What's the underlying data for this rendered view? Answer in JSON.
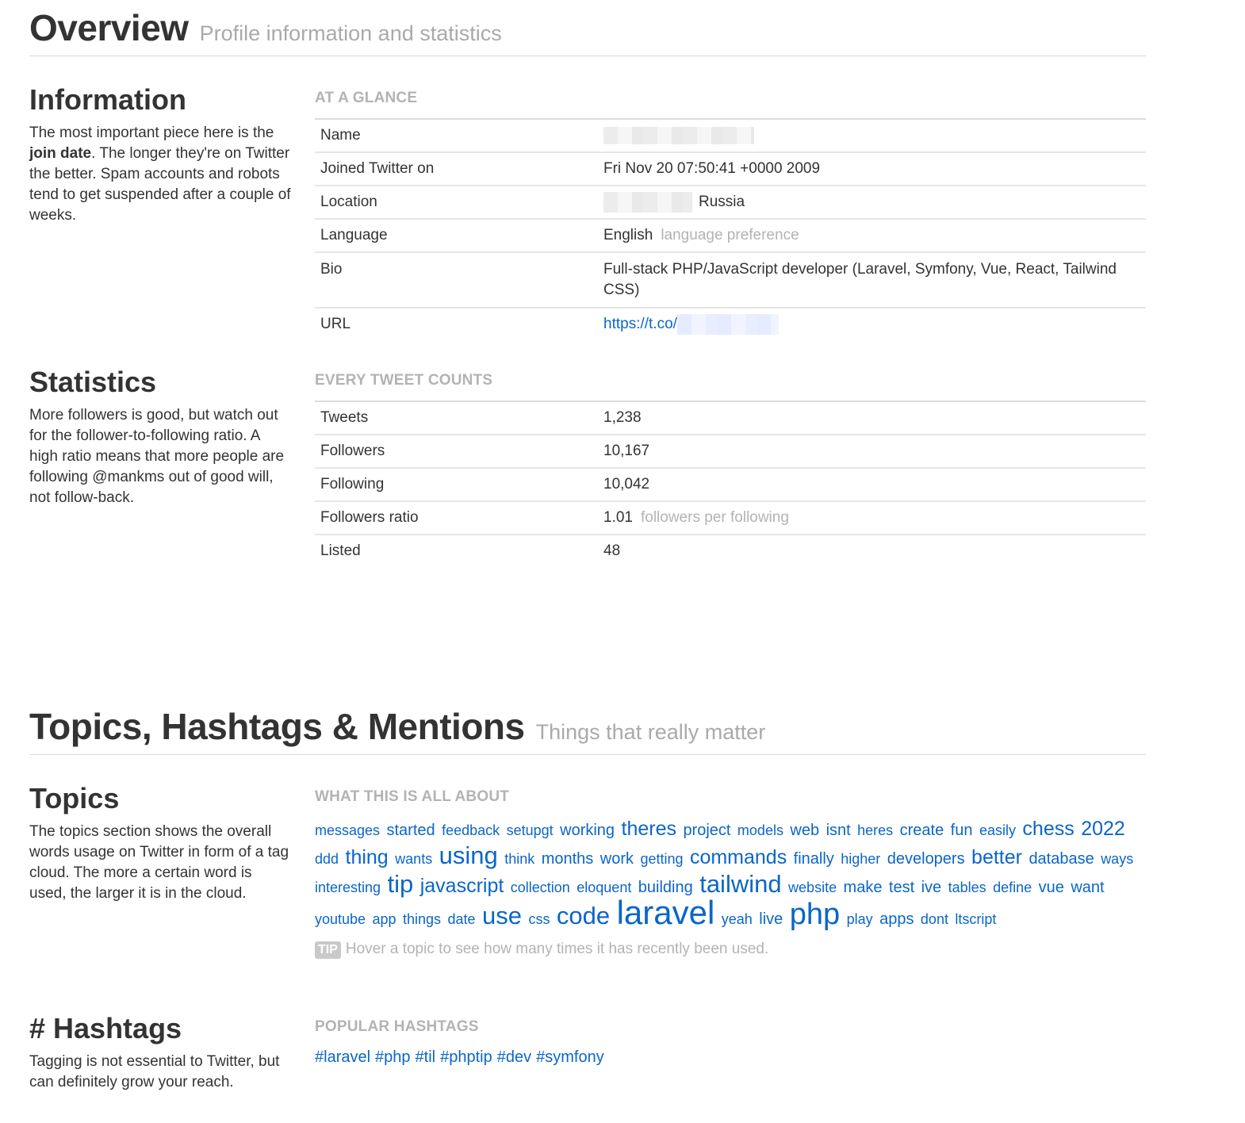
{
  "overview": {
    "title": "Overview",
    "subtitle": "Profile information and statistics"
  },
  "information": {
    "heading": "Information",
    "desc_pre": "The most important piece here is the ",
    "desc_bold": "join date",
    "desc_post": ". The longer they're on Twitter the better. Spam accounts and robots tend to get suspended after a couple of weeks.",
    "caption": "AT A GLANCE",
    "rows": {
      "name_label": "Name",
      "joined_label": "Joined Twitter on",
      "joined_value": "Fri Nov 20 07:50:41 +0000 2009",
      "location_label": "Location",
      "location_value": "Russia",
      "language_label": "Language",
      "language_value": "English",
      "language_note": "language preference",
      "bio_label": "Bio",
      "bio_value": "Full-stack PHP/JavaScript developer (Laravel, Symfony, Vue, React, Tailwind CSS)",
      "url_label": "URL",
      "url_value": "https://t.co/"
    }
  },
  "statistics": {
    "heading": "Statistics",
    "desc": "More followers is good, but watch out for the follower-to-following ratio. A high ratio means that more people are following @mankms out of good will, not follow-back.",
    "caption": "EVERY TWEET COUNTS",
    "rows": {
      "tweets_label": "Tweets",
      "tweets_value": "1,238",
      "followers_label": "Followers",
      "followers_value": "10,167",
      "following_label": "Following",
      "following_value": "10,042",
      "ratio_label": "Followers ratio",
      "ratio_value": "1.01",
      "ratio_note": "followers per following",
      "listed_label": "Listed",
      "listed_value": "48"
    }
  },
  "topics_header": {
    "title": "Topics, Hashtags & Mentions",
    "subtitle": "Things that really matter"
  },
  "topics": {
    "heading": "Topics",
    "desc": "The topics section shows the overall words usage on Twitter in form of a tag cloud. The more a certain word is used, the larger it is in the cloud.",
    "caption": "WHAT THIS IS ALL ABOUT",
    "words": [
      {
        "text": "messages",
        "size": 1
      },
      {
        "text": "started",
        "size": 2
      },
      {
        "text": "feedback",
        "size": 1
      },
      {
        "text": "setupgt",
        "size": 1
      },
      {
        "text": "working",
        "size": 2
      },
      {
        "text": "theres",
        "size": 3
      },
      {
        "text": "project",
        "size": 2
      },
      {
        "text": "models",
        "size": 1
      },
      {
        "text": "web",
        "size": 2
      },
      {
        "text": "isnt",
        "size": 2
      },
      {
        "text": "heres",
        "size": 1
      },
      {
        "text": "create",
        "size": 2
      },
      {
        "text": "fun",
        "size": 2
      },
      {
        "text": "easily",
        "size": 1
      },
      {
        "text": "chess",
        "size": 3
      },
      {
        "text": "2022",
        "size": 3
      },
      {
        "text": "ddd",
        "size": 1
      },
      {
        "text": "thing",
        "size": 3
      },
      {
        "text": "wants",
        "size": 1
      },
      {
        "text": "using",
        "size": 4
      },
      {
        "text": "think",
        "size": 1
      },
      {
        "text": "months",
        "size": 2
      },
      {
        "text": "work",
        "size": 2
      },
      {
        "text": "getting",
        "size": 1
      },
      {
        "text": "commands",
        "size": 3
      },
      {
        "text": "finally",
        "size": 2
      },
      {
        "text": "higher",
        "size": 1
      },
      {
        "text": "developers",
        "size": 2
      },
      {
        "text": "better",
        "size": 3
      },
      {
        "text": "database",
        "size": 2
      },
      {
        "text": "ways",
        "size": 1
      },
      {
        "text": "interesting",
        "size": 1
      },
      {
        "text": "tip",
        "size": 4
      },
      {
        "text": "javascript",
        "size": 3
      },
      {
        "text": "collection",
        "size": 1
      },
      {
        "text": "eloquent",
        "size": 1
      },
      {
        "text": "building",
        "size": 2
      },
      {
        "text": "tailwind",
        "size": 4
      },
      {
        "text": "website",
        "size": 1
      },
      {
        "text": "make",
        "size": 2
      },
      {
        "text": "test",
        "size": 2
      },
      {
        "text": "ive",
        "size": 2
      },
      {
        "text": "tables",
        "size": 1
      },
      {
        "text": "define",
        "size": 1
      },
      {
        "text": "vue",
        "size": 2
      },
      {
        "text": "want",
        "size": 2
      },
      {
        "text": "youtube",
        "size": 1
      },
      {
        "text": "app",
        "size": 1
      },
      {
        "text": "things",
        "size": 1
      },
      {
        "text": "date",
        "size": 1
      },
      {
        "text": "use",
        "size": 4
      },
      {
        "text": "css",
        "size": 1
      },
      {
        "text": "code",
        "size": 4
      },
      {
        "text": "laravel",
        "size": 6
      },
      {
        "text": "yeah",
        "size": 1
      },
      {
        "text": "live",
        "size": 2
      },
      {
        "text": "php",
        "size": 5
      },
      {
        "text": "play",
        "size": 1
      },
      {
        "text": "apps",
        "size": 2
      },
      {
        "text": "dont",
        "size": 1
      },
      {
        "text": "ltscript",
        "size": 1
      }
    ],
    "tip_badge": "TIP",
    "tip_text": "Hover a topic to see how many times it has recently been used."
  },
  "hashtags": {
    "heading": "# Hashtags",
    "desc": "Tagging is not essential to Twitter, but can definitely grow your reach.",
    "caption": "POPULAR HASHTAGS",
    "tags": [
      "#laravel",
      "#php",
      "#til",
      "#phptip",
      "#dev",
      "#symfony"
    ]
  },
  "colors": {
    "link": "#0b66c8",
    "muted": "#b3b3b3",
    "text": "#333333"
  }
}
